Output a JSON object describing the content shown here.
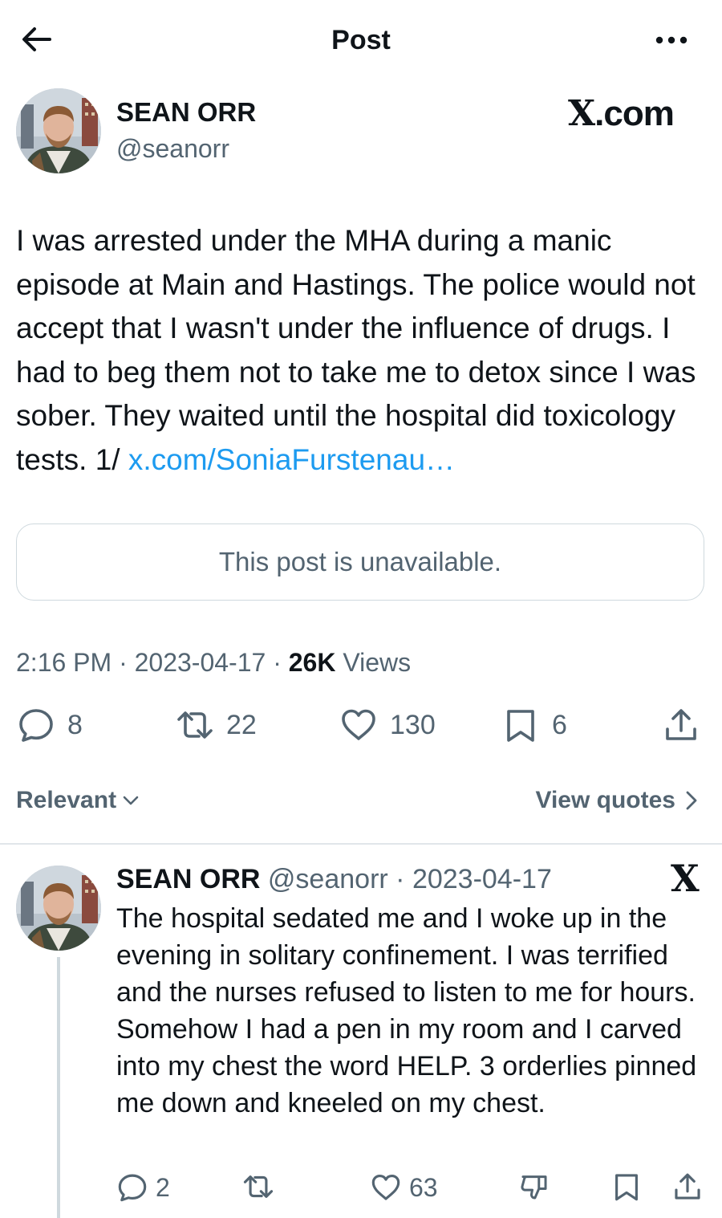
{
  "header": {
    "title": "Post"
  },
  "icons": {
    "back": "arrow-left-icon",
    "more": "more-horizontal-icon",
    "reply": "reply-bubble-icon",
    "repost": "repost-icon",
    "like": "heart-icon",
    "bookmark": "bookmark-icon",
    "share": "share-icon",
    "downvote": "downvote-icon"
  },
  "brand": {
    "x": "X",
    "rest": ".com"
  },
  "post": {
    "author_name": "SEAN ORR",
    "author_handle": "@seanorr",
    "text": "I was arrested under the MHA during a manic episode at Main and Hastings. The police would not accept that I wasn't under the influence of drugs. I had to beg them not to take me to detox since I was sober. They waited until the hospital did toxicology tests. 1/ ",
    "link": "x.com/SoniaFurstenau…",
    "unavailable": "This post is unavailable.",
    "time": "2:16 PM",
    "sep1": " · ",
    "date": "2023-04-17",
    "sep2": " · ",
    "views_count": "26K",
    "views_label": " Views",
    "stats": {
      "replies": "8",
      "reposts": "22",
      "likes": "130",
      "bookmarks": "6"
    }
  },
  "sort": {
    "label": "Relevant",
    "view_quotes": "View quotes"
  },
  "reply": {
    "author_name": "SEAN ORR",
    "author_handle": "@seanorr",
    "dot": " · ",
    "date": "2023-04-17",
    "x_logo": "X",
    "text": "The hospital sedated me and I woke up in the evening in solitary confinement. I was terrified and the nurses refused to listen to me for hours. Somehow I had a pen in my room and I carved into my chest the word HELP. 3 orderlies pinned me down and kneeled on my chest.",
    "stats": {
      "replies": "2",
      "likes": "63"
    }
  },
  "colors": {
    "link": "#1d9bf0",
    "secondary": "#536471",
    "text": "#0f1419",
    "border": "#cfd9de"
  }
}
